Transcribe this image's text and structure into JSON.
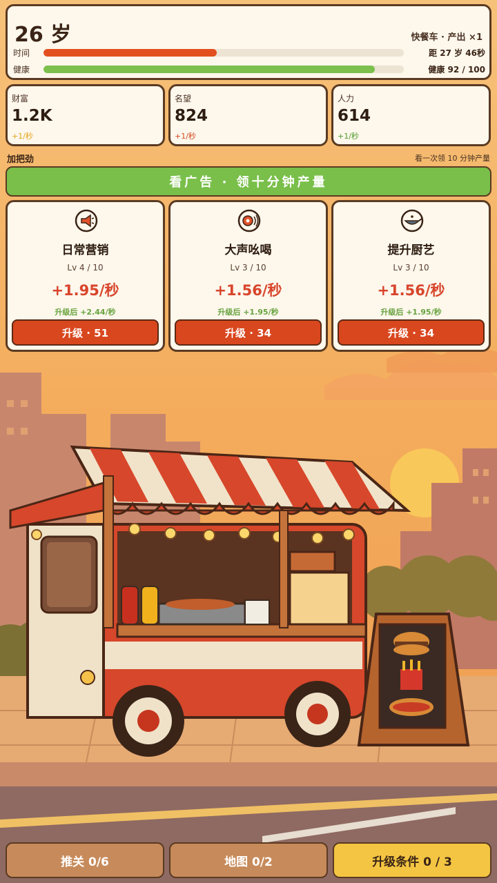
{
  "header": {
    "age": "26 岁",
    "vehicle": "快餐车 · 产出 ×1",
    "time_label": "时间",
    "time_remaining": "距 27 岁 46秒",
    "time_progress": 0.48,
    "health_label": "健康",
    "health_value": "健康 92 / 100",
    "health_progress": 0.92
  },
  "stats": [
    {
      "name": "财富",
      "value": "1.2K",
      "rate": "+1/秒"
    },
    {
      "name": "名望",
      "value": "824",
      "rate": "+1/秒"
    },
    {
      "name": "人力",
      "value": "614",
      "rate": "+1/秒"
    }
  ],
  "boost": {
    "title": "加把劲",
    "note": "看一次领 10 分钟产量",
    "ad_button": "看广告 · 领十分钟产量"
  },
  "upgrades": [
    {
      "icon": "megaphone-icon",
      "title": "日常营销",
      "level": "Lv 4 / 10",
      "rate": "+1.95/秒",
      "next": "升级后 +2.44/秒",
      "button": "升级 · 51"
    },
    {
      "icon": "shout-icon",
      "title": "大声吆喝",
      "level": "Lv 3 / 10",
      "rate": "+1.56/秒",
      "next": "升级后 +1.95/秒",
      "button": "升级 · 34"
    },
    {
      "icon": "wok-icon",
      "title": "提升厨艺",
      "level": "Lv 3 / 10",
      "rate": "+1.56/秒",
      "next": "升级后 +1.95/秒",
      "button": "升级 · 34"
    }
  ],
  "nav": {
    "levels": "推关 0/6",
    "map": "地图 0/2",
    "upgrade_conditions": "升级条件 0 / 3"
  },
  "colors": {
    "time_bar": "#e3501f",
    "health_bar": "#7cc04d",
    "ad_button": "#79bf4a",
    "upgrade_button": "#d9471f",
    "accent_rate": "#d8452b",
    "nav_highlight": "#f4c542"
  }
}
